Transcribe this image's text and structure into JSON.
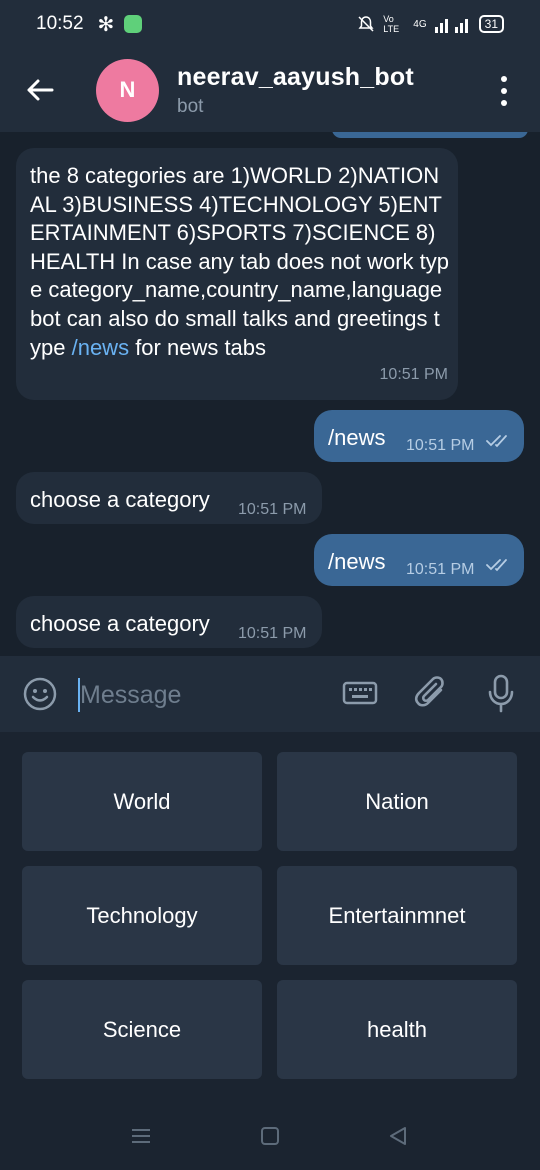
{
  "status_bar": {
    "time": "10:52",
    "network_label": "Vo LTE",
    "network_type": "4G",
    "battery": "31"
  },
  "header": {
    "avatar_letter": "N",
    "title": "neerav_aayush_bot",
    "subtitle": "bot",
    "avatar_color": "#ee7aa0"
  },
  "messages": [
    {
      "direction": "in",
      "text_before_link": "the 8 categories are   1)WORLD  2)NATIONAL  3)BUSINESS  4)TECHNOLOGY  5)ENTERTAINMENT  6)SPORTS  7)SCIENCE  8)HEALTH    In case any tab does not work type category_name,country_name,language  bot can also do small talks and greetings type ",
      "link": "/news",
      "text_after_link": " for news tabs",
      "time": "10:51 PM"
    },
    {
      "direction": "out",
      "text": "/news",
      "time": "10:51 PM",
      "read": true
    },
    {
      "direction": "in",
      "text": "choose a category",
      "time": "10:51 PM"
    },
    {
      "direction": "out",
      "text": "/news",
      "time": "10:51 PM",
      "read": true
    },
    {
      "direction": "in",
      "text": "choose a category",
      "time": "10:51 PM"
    }
  ],
  "input": {
    "placeholder": "Message"
  },
  "reply_keyboard": [
    [
      "World",
      "Nation"
    ],
    [
      "Technology",
      "Entertainmnet"
    ],
    [
      "Science",
      "health"
    ]
  ],
  "colors": {
    "chat_bg": "#18212c",
    "incoming_bubble": "#222d3b",
    "outgoing_bubble": "#3a6795",
    "link": "#6ab2f2"
  }
}
